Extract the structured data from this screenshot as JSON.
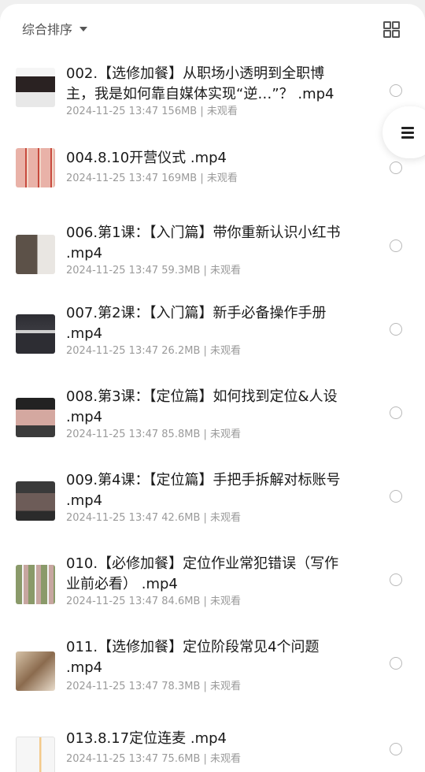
{
  "header": {
    "sort_label": "综合排序",
    "sort_icon": "caret-down-icon",
    "view_icon": "grid-view-icon"
  },
  "floating": {
    "icon": "list-menu-icon"
  },
  "items": [
    {
      "title": "002.【选修加餐】从职场小透明到全职博主，我是如何靠自媒体实现“逆…”？ .mp4",
      "meta": "2024-11-25 13:47  156MB | 未观看"
    },
    {
      "title": "004.8.10开营仪式 .mp4",
      "meta": "2024-11-25 13:47  169MB | 未观看"
    },
    {
      "title": "006.第1课：【入门篇】带你重新认识小红书 .mp4",
      "meta": "2024-11-25 13:47  59.3MB | 未观看"
    },
    {
      "title": "007.第2课：【入门篇】新手必备操作手册 .mp4",
      "meta": "2024-11-25 13:47  26.2MB | 未观看"
    },
    {
      "title": "008.第3课：【定位篇】如何找到定位&人设 .mp4",
      "meta": "2024-11-25 13:47  85.8MB | 未观看"
    },
    {
      "title": "009.第4课：【定位篇】手把手拆解对标账号 .mp4",
      "meta": "2024-11-25 13:47  42.6MB | 未观看"
    },
    {
      "title": "010.【必修加餐】定位作业常犯错误（写作业前必看） .mp4",
      "meta": "2024-11-25 13:47  84.6MB | 未观看"
    },
    {
      "title": "011.【选修加餐】定位阶段常见4个问题 .mp4",
      "meta": "2024-11-25 13:47  78.3MB | 未观看"
    },
    {
      "title": "013.8.17定位连麦 .mp4",
      "meta": "2024-11-25 13:47  75.6MB | 未观看"
    }
  ]
}
